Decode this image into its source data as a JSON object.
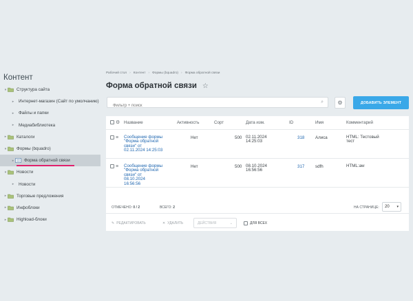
{
  "sidebar": {
    "title": "Контент",
    "items": [
      {
        "label": "Структура сайта",
        "level": 0,
        "expanded": true
      },
      {
        "label": "Интернет-магазин (Сайт по умолчанию)",
        "level": 1,
        "expanded": false
      },
      {
        "label": "Файлы и папки",
        "level": 1,
        "expanded": false
      },
      {
        "label": "Медиабиблиотека",
        "level": 1,
        "expanded": false
      },
      {
        "label": "Каталоги",
        "level": 0,
        "expanded": false
      },
      {
        "label": "Формы (bquadro)",
        "level": 0,
        "expanded": true
      },
      {
        "label": "Форма обратной связи",
        "level": 1,
        "active": true
      },
      {
        "label": "Новости",
        "level": 0,
        "expanded": true
      },
      {
        "label": "Новости",
        "level": 1
      },
      {
        "label": "Торговые предложения",
        "level": 0
      },
      {
        "label": "Инфоблоки",
        "level": 0
      },
      {
        "label": "Highload-блоки",
        "level": 0
      }
    ]
  },
  "breadcrumb": [
    "Рабочий стол",
    "Контент",
    "Формы (bquadro)",
    "Форма обратной связи"
  ],
  "page_title": "Форма обратной связи",
  "filter": {
    "placeholder": "Фильтр + поиск"
  },
  "toolbar": {
    "add_label": "ДОБАВИТЬ ЭЛЕМЕНТ"
  },
  "table": {
    "headers": [
      "Название",
      "Активность",
      "Сорт",
      "Дата изм.",
      "ID",
      "Имя",
      "Комментарий"
    ],
    "rows": [
      {
        "name": [
          "Сообщение формы",
          "\"Форма обратной",
          "связи\" от",
          "02.11.2024 14:25:03"
        ],
        "active": "Нет",
        "sort": "500",
        "date": [
          "02.11.2024",
          "14:25:03"
        ],
        "id": "318",
        "user": "Алиса",
        "comment": [
          "HTML: Тестовый",
          "тест"
        ]
      },
      {
        "name": [
          "Сообщение формы",
          "\"Форма обратной",
          "связи\" от",
          "08.10.2024",
          "16:56:56"
        ],
        "active": "Нет",
        "sort": "500",
        "date": [
          "08.10.2024",
          "16:56:56"
        ],
        "id": "317",
        "user": "sdfh",
        "comment": [
          "HTML:aw"
        ]
      }
    ]
  },
  "footer": {
    "selected_label": "ОТМЕЧЕНО:",
    "selected_value": "0 / 2",
    "total_label": "ВСЕГО:",
    "total_value": "2",
    "per_page_label": "НА СТРАНИЦЕ:",
    "per_page_value": "20"
  },
  "actions": {
    "edit": "РЕДАКТИРОВАТЬ",
    "delete": "УДАЛИТЬ",
    "actions_select": "ДЕЙСТВИЯ",
    "for_all": "ДЛЯ ВСЕХ"
  },
  "colors": {
    "accent": "#3aa8e8",
    "link": "#2067b0",
    "active_marker": "#e0206c"
  }
}
